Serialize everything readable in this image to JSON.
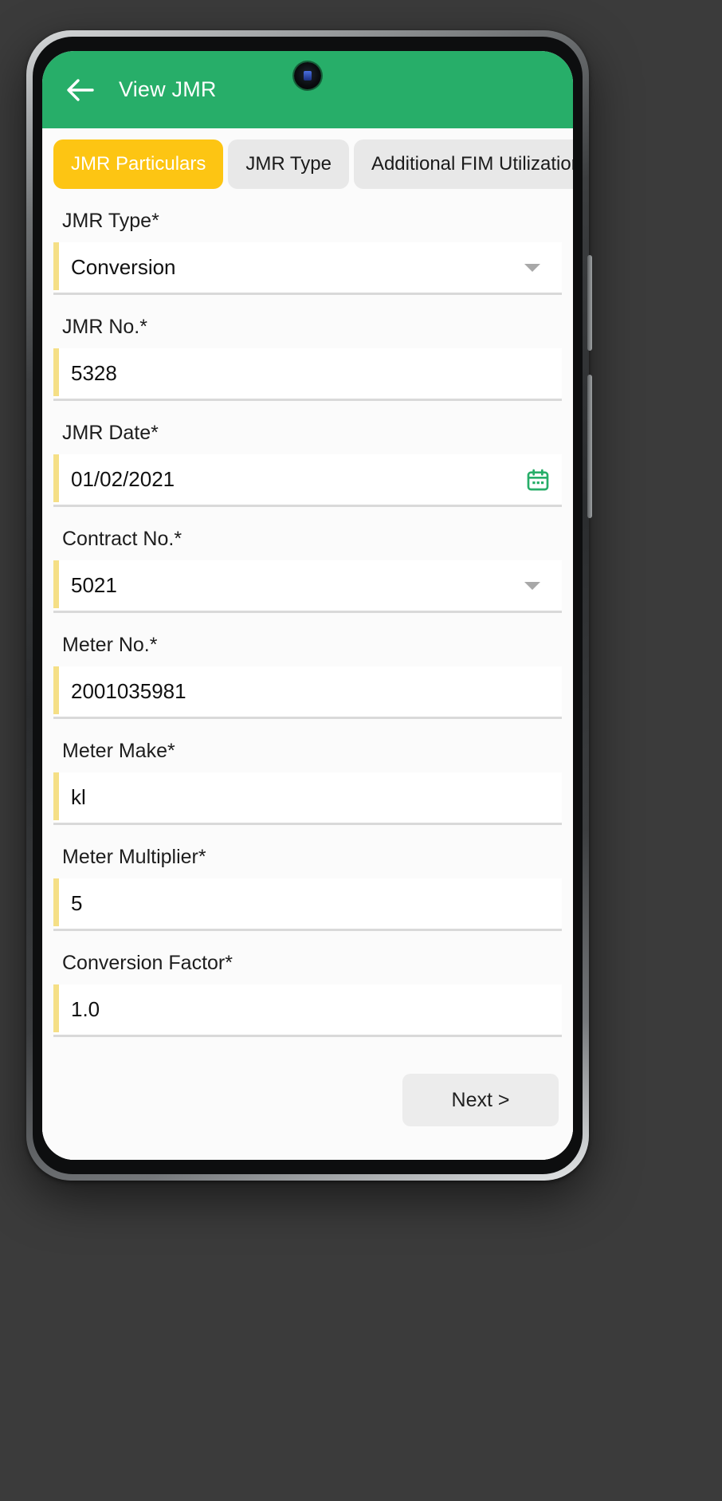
{
  "appbar": {
    "title": "View JMR",
    "back_icon": "arrow-left-icon",
    "background_color": "#27ae69",
    "title_color": "#ffffff"
  },
  "tabs": [
    {
      "label": "JMR Particulars",
      "active": true,
      "bg": "#fdc513",
      "fg": "#ffffff"
    },
    {
      "label": "JMR Type",
      "active": false,
      "bg": "#e8e8e8",
      "fg": "#1b1b1b"
    },
    {
      "label": "Additional FIM Utilization",
      "active": false,
      "bg": "#e8e8e8",
      "fg": "#1b1b1b"
    }
  ],
  "form": {
    "accent_bar_color": "#f5df86",
    "fields": [
      {
        "label": "JMR Type*",
        "value": "Conversion",
        "control": "dropdown"
      },
      {
        "label": "JMR No.*",
        "value": "5328",
        "control": "text"
      },
      {
        "label": "JMR Date*",
        "value": "01/02/2021",
        "control": "date"
      },
      {
        "label": "Contract No.*",
        "value": "5021",
        "control": "dropdown"
      },
      {
        "label": "Meter No.*",
        "value": "2001035981",
        "control": "text"
      },
      {
        "label": "Meter Make*",
        "value": "kl",
        "control": "text"
      },
      {
        "label": "Meter Multiplier*",
        "value": "5",
        "control": "text"
      },
      {
        "label": "Conversion Factor*",
        "value": "1.0",
        "control": "text"
      }
    ]
  },
  "footer": {
    "next_label": "Next >"
  },
  "icons": {
    "calendar": "calendar-icon",
    "calendar_color": "#27ae69",
    "dropdown": "chevron-down-icon"
  }
}
